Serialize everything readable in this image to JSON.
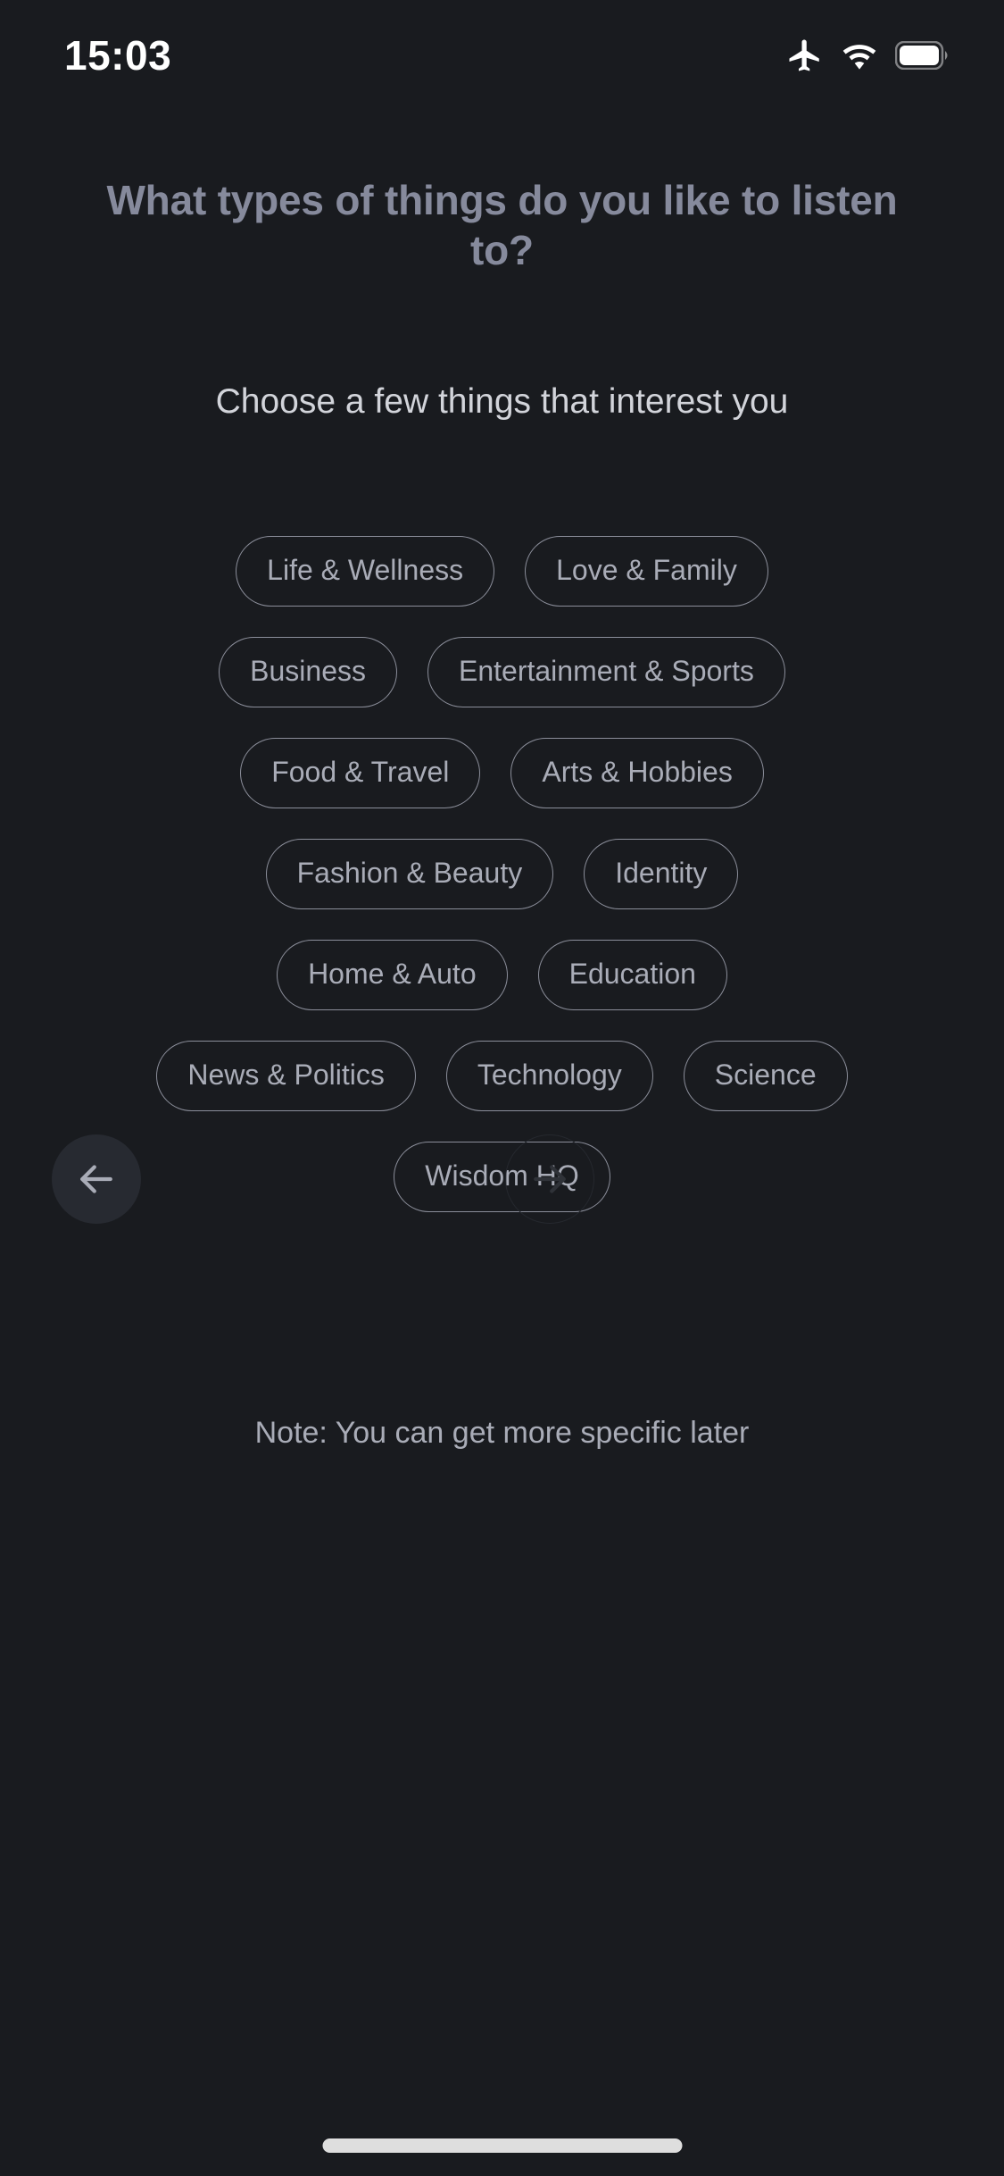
{
  "status_bar": {
    "time": "15:03",
    "icons": [
      "airplane-mode-icon",
      "wifi-icon",
      "battery-icon"
    ]
  },
  "screen": {
    "heading": "What types of things do you like to listen to?",
    "subtitle": "Choose a few things that interest you",
    "note": "Note: You can get more specific later"
  },
  "interests": {
    "rows": [
      [
        "Life & Wellness",
        "Love & Family"
      ],
      [
        "Business",
        "Entertainment & Sports"
      ],
      [
        "Food & Travel",
        "Arts & Hobbies"
      ],
      [
        "Fashion & Beauty",
        "Identity"
      ],
      [
        "Home & Auto",
        "Education"
      ],
      [
        "News & Politics",
        "Technology",
        "Science"
      ],
      [
        "Wisdom HQ"
      ]
    ]
  },
  "navigation": {
    "back_icon": "arrow-left-icon",
    "next_icon": "arrow-right-icon",
    "next_disabled": true
  },
  "colors": {
    "background": "#191b1f",
    "heading_text": "#868a9c",
    "subtitle_text": "#d2d4da",
    "chip_border": "#8b8e9a",
    "chip_text": "#a9acb7",
    "note_text": "#a9acb7",
    "back_button_bg": "#272a31",
    "next_button_border": "#25282e",
    "next_arrow": "#2f3238",
    "home_indicator": "#dedede"
  }
}
